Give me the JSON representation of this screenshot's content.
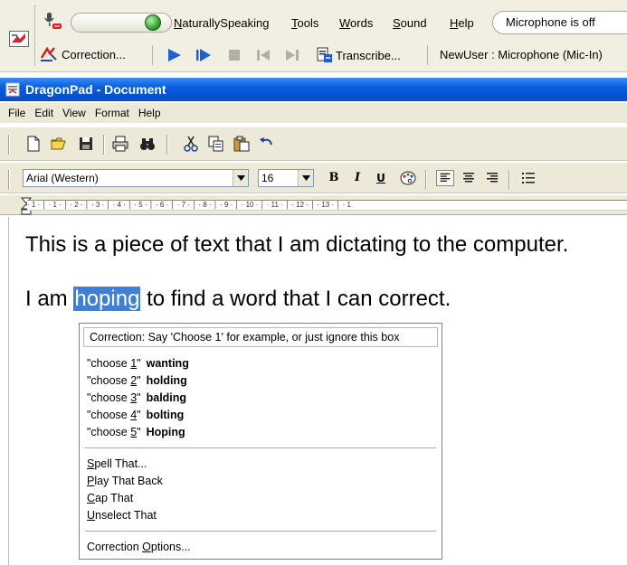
{
  "dragon_bar": {
    "menu": [
      {
        "label": "NaturallySpeaking",
        "accel_index": 0
      },
      {
        "label": "Tools",
        "accel_index": 0
      },
      {
        "label": "Words",
        "accel_index": 0
      },
      {
        "label": "Sound",
        "accel_index": 0
      },
      {
        "label": "Help",
        "accel_index": 0
      }
    ],
    "mic_status": "Microphone is off",
    "correction_label": "Correction...",
    "transcribe_label": "Transcribe...",
    "user_status": "NewUser : Microphone (Mic-In)"
  },
  "window": {
    "title": "DragonPad - Document"
  },
  "menubar": [
    "File",
    "Edit",
    "View",
    "Format",
    "Help"
  ],
  "format": {
    "font": "Arial (Western)",
    "size": "16",
    "bold": "B",
    "italic": "I",
    "underline": "U"
  },
  "ruler": {
    "text": "· 1 · │ · 1 · │ · 2 · │ · 3 · │ · 4 · │ · 5 · │ · 6 · │ · 7 · │ · 8 · │ · 9 · │ · 10 · │ · 11 · │ · 12 · │ · 13 · │ · 1"
  },
  "document": {
    "line1": "This is a piece of text that I am dictating to the computer.",
    "line2_before": "I am ",
    "line2_selected": "hoping",
    "line2_after": " to find a word that I can correct."
  },
  "correction_popup": {
    "header": "Correction: Say 'Choose 1' for example, or just ignore this box",
    "choices": [
      {
        "prefix": "\"choose ",
        "num": "1",
        "suffix": "\"",
        "word": "wanting"
      },
      {
        "prefix": "\"choose ",
        "num": "2",
        "suffix": "\"",
        "word": "holding"
      },
      {
        "prefix": "\"choose ",
        "num": "3",
        "suffix": "\"",
        "word": "balding"
      },
      {
        "prefix": "\"choose ",
        "num": "4",
        "suffix": "\"",
        "word": "bolting"
      },
      {
        "prefix": "\"choose ",
        "num": "5",
        "suffix": "\"",
        "word": "Hoping"
      }
    ],
    "commands": [
      {
        "first": "S",
        "rest": "pell That..."
      },
      {
        "first": "P",
        "rest": "lay That Back"
      },
      {
        "first": "C",
        "rest": "ap That"
      },
      {
        "first": "U",
        "rest": "nselect That"
      }
    ],
    "options": {
      "before": "Correction ",
      "accel": "O",
      "after": "ptions..."
    }
  }
}
